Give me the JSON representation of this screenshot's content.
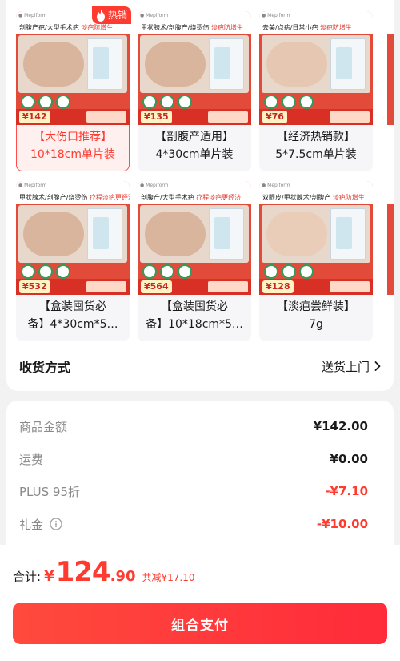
{
  "skus": [
    {
      "label": "【大伤口推荐】\n10*18cm单片装",
      "price": "142",
      "tagline": "剖腹产疤/大型手术疤",
      "tagline_hl": "淡疤防增生",
      "selected": true,
      "hot_tag": "热销"
    },
    {
      "label": "【剖腹产适用】\n4*30cm单片装",
      "price": "135",
      "tagline": "甲状腺术/剖腹产/烧烫伤",
      "tagline_hl": "淡疤防增生",
      "selected": false
    },
    {
      "label": "【经济热销款】\n5*7.5cm单片装",
      "price": "76",
      "tagline": "去美/点痣/日常小疤",
      "tagline_hl": "淡疤防增生",
      "selected": false
    },
    {
      "label": "【盒装囤货必\n备】4*30cm*5…",
      "price": "532",
      "tagline": "甲状腺术/剖腹产/烧烫伤",
      "tagline_hl": "疗程淡疤更经济",
      "selected": false
    },
    {
      "label": "【盒装囤货必\n备】10*18cm*5…",
      "price": "564",
      "tagline": "剖腹产/大型手术疤",
      "tagline_hl": "疗程淡疤更经济",
      "selected": false
    },
    {
      "label": "【淡疤尝鲜装】\n7g",
      "price": "128",
      "tagline": "双眼皮/甲状腺术/剖腹产",
      "tagline_hl": "淡疤防增生",
      "selected": false
    }
  ],
  "delivery": {
    "title": "收货方式",
    "value": "送货上门"
  },
  "fees": [
    {
      "label": "商品金额",
      "value": "¥142.00",
      "red": false,
      "info": false
    },
    {
      "label": "运费",
      "value": "¥0.00",
      "red": false,
      "info": false
    },
    {
      "label": "PLUS 95折",
      "value": "-¥7.10",
      "red": true,
      "info": false
    },
    {
      "label": "礼金",
      "value": "-¥10.00",
      "red": true,
      "info": true
    }
  ],
  "total": {
    "label": "合计:",
    "currency": "¥",
    "integer": "124",
    "decimal": ".90",
    "savings": "共减¥17.10"
  },
  "pay_button": "组合支付",
  "colors": {
    "accent": "#ff3b30",
    "badge_green": "#2f9c5a",
    "thumb_red": "#e24b3a"
  }
}
